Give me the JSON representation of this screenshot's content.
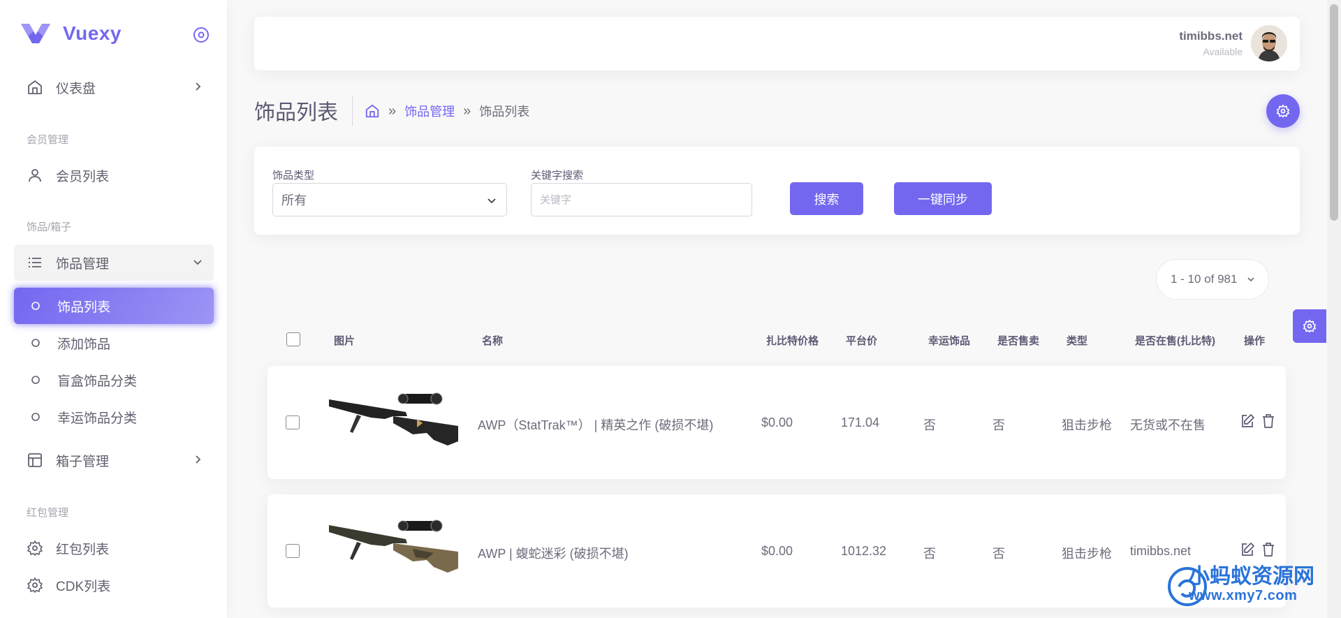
{
  "app": {
    "brand": "Vuexy"
  },
  "sidebar": {
    "dashboard": "仪表盘",
    "sections": {
      "member": "会员管理",
      "items": "饰品/箱子",
      "redpacket": "红包管理"
    },
    "member_list": "会员列表",
    "item_manage": "饰品管理",
    "sub_items": [
      "饰品列表",
      "添加饰品",
      "盲盒饰品分类",
      "幸运饰品分类"
    ],
    "box_manage": "箱子管理",
    "redpacket_list": "红包列表",
    "cdk_list": "CDK列表"
  },
  "navbar": {
    "user_name": "timibbs.net",
    "user_status": "Available"
  },
  "page": {
    "title": "饰品列表",
    "breadcrumb": {
      "parent": "饰品管理",
      "current": "饰品列表",
      "separator": "»"
    }
  },
  "filters": {
    "type_label": "饰品类型",
    "type_value": "所有",
    "keyword_label": "关键字搜索",
    "keyword_placeholder": "关键字",
    "search_button": "搜索",
    "sync_button": "一键同步"
  },
  "pagination": {
    "text": "1 - 10 of 981"
  },
  "table": {
    "headers": [
      "图片",
      "名称",
      "扎比特价格",
      "平台价",
      "幸运饰品",
      "是否售卖",
      "类型",
      "是否在售(扎比特)",
      "操作"
    ],
    "rows": [
      {
        "name": "AWP（StatTrak™） | 精英之作 (破损不堪)",
        "zbt_price": "$0.00",
        "platform_price": "171.04",
        "lucky": "否",
        "on_sale": "否",
        "type": "狙击步枪",
        "zbt_status": "无货或不在售"
      },
      {
        "name": "AWP | 蝮蛇迷彩 (破损不堪)",
        "zbt_price": "$0.00",
        "platform_price": "1012.32",
        "lucky": "否",
        "on_sale": "否",
        "type": "狙击步枪",
        "zbt_status": "timibbs.net"
      }
    ]
  },
  "watermark": {
    "title": "小蚂蚁资源网",
    "url": "www.xmy7.com"
  },
  "colors": {
    "primary": "#7367f0",
    "text": "#6e6b7b",
    "heading": "#5e5873"
  }
}
